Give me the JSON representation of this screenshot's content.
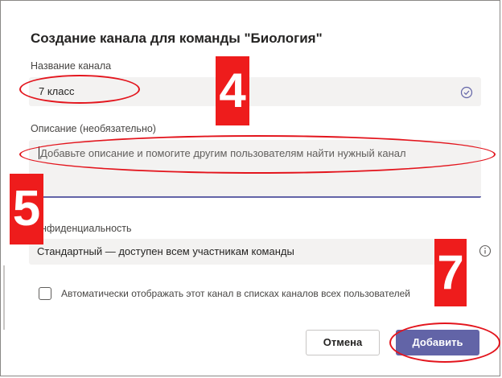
{
  "dialog": {
    "title": "Создание канала для команды \"Биология\"",
    "channel_name_label": "Название канала",
    "channel_name_value": "7 класс",
    "description_label": "Описание (необязательно)",
    "description_placeholder": "Добавьте описание и помогите другим пользователям найти нужный канал",
    "privacy_label": "онфиденциальность",
    "privacy_value": "Стандартный — доступен всем участникам команды",
    "auto_show_label": "Автоматически отображать этот канал в списках каналов всех пользователей",
    "auto_show_checked": false,
    "cancel_label": "Отмена",
    "add_label": "Добавить"
  },
  "annotations": {
    "step_4": "4",
    "step_5": "5",
    "step_7": "7"
  },
  "colors": {
    "accent": "#6264a7",
    "annotation_red": "#ee1c1c",
    "field_bg": "#f3f2f1"
  },
  "icons": {
    "channel_name_valid": "check-circle-icon",
    "privacy_dropdown": "chevron-down-icon",
    "privacy_info": "info-icon"
  }
}
